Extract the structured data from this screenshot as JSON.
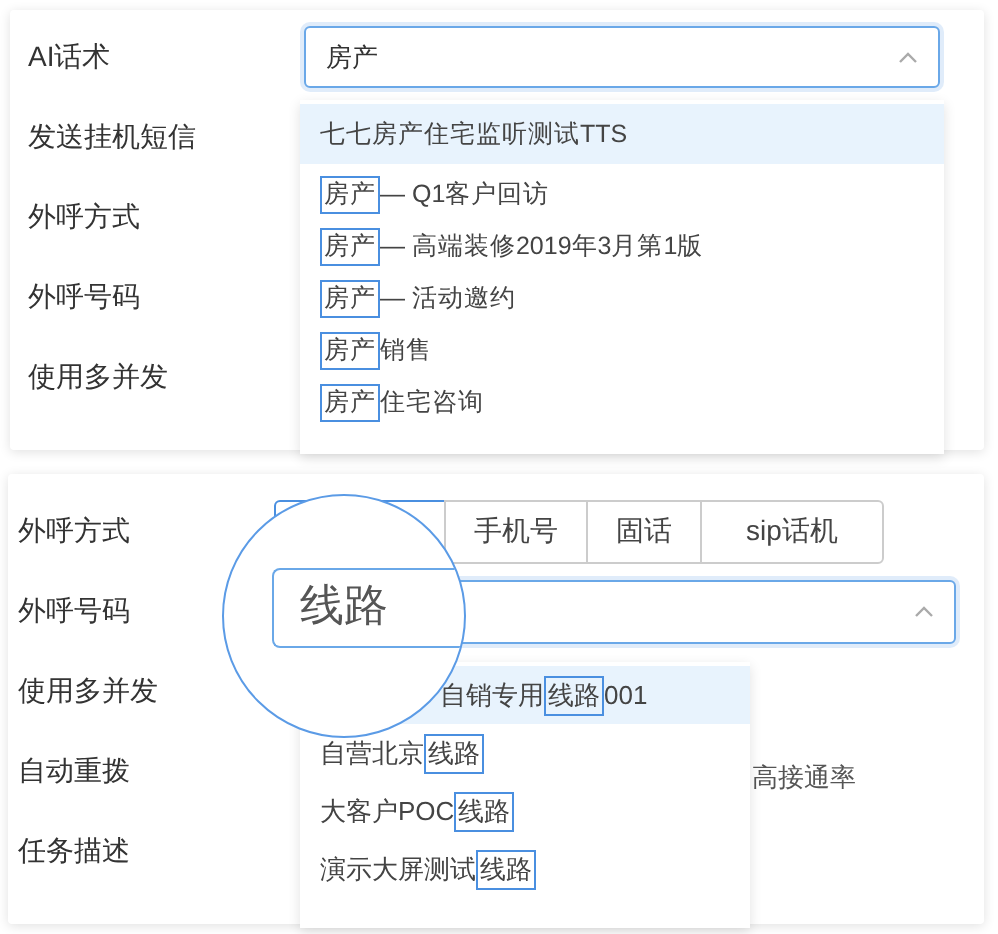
{
  "card_1": {
    "labels": [
      "AI话术",
      "发送挂机短信",
      "外呼方式",
      "外呼号码",
      "使用多并发"
    ],
    "select": {
      "value": "房产",
      "expanded": true
    },
    "options": [
      {
        "kind": "plain",
        "text": "七七房产住宅监听测试TTS",
        "selected": true
      },
      {
        "kind": "match",
        "match": "房产",
        "suffix": "— Q1客户回访",
        "selected": false
      },
      {
        "kind": "match",
        "match": "房产",
        "suffix": "— 高端装修2019年3月第1版",
        "selected": false
      },
      {
        "kind": "match",
        "match": "房产",
        "suffix": "— 活动邀约",
        "selected": false
      },
      {
        "kind": "match",
        "match": "房产",
        "suffix": "销售",
        "selected": false
      },
      {
        "kind": "match",
        "match": "房产",
        "suffix": "住宅咨询",
        "selected": false
      }
    ]
  },
  "card_2": {
    "labels": [
      "外呼方式",
      "外呼号码",
      "使用多并发",
      "自动重拨",
      "任务描述"
    ],
    "segments": [
      {
        "selected": true
      },
      {
        "label": "手机号",
        "selected": false
      },
      {
        "label": "固话",
        "selected": false
      },
      {
        "label": "sip话机",
        "selected": false
      }
    ],
    "select": {
      "expanded": true
    },
    "magnifier": {
      "text": "线路"
    },
    "behind_text": "高接通率",
    "options": [
      {
        "prefix": "自销专用",
        "match": "线路",
        "suffix": "001",
        "selected": true
      },
      {
        "prefix": "自营北京",
        "match": "线路",
        "selected": false
      },
      {
        "prefix": "大客户POC",
        "match": "线路",
        "selected": false
      },
      {
        "prefix": "演示大屏测试",
        "match": "线路",
        "selected": false
      }
    ]
  }
}
